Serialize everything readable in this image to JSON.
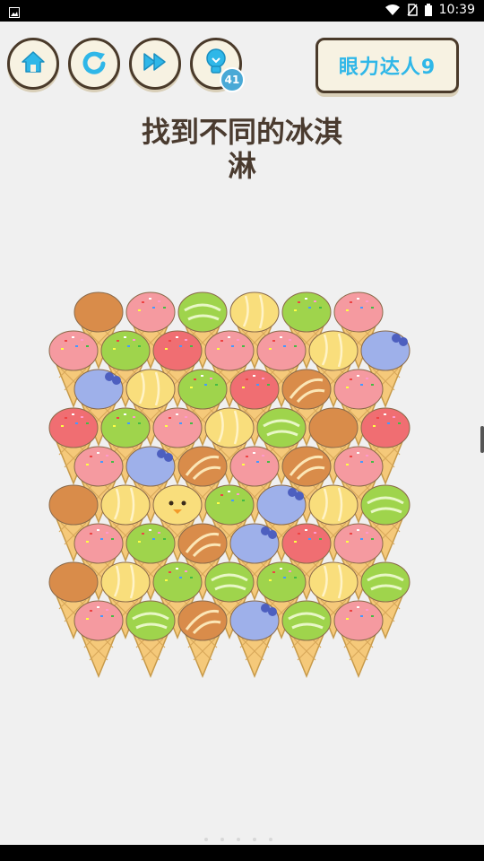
{
  "status_bar": {
    "time": "10:39"
  },
  "toolbar": {
    "home_icon": "home-icon",
    "restart_icon": "restart-icon",
    "skip_icon": "skip-icon",
    "hint_icon": "lightbulb-icon",
    "hint_count": "41"
  },
  "level": {
    "label": "眼力达人9"
  },
  "prompt": {
    "line1": "找到不同的冰淇",
    "line2": "淋"
  },
  "colors": {
    "brown": "#d98c4a",
    "pink": "#f59aa0",
    "green": "#9fd44c",
    "yellow": "#f9de7c",
    "blue": "#9eb0ea",
    "red": "#f06e72",
    "cone": "#f5c97a"
  },
  "board": {
    "rows": [
      [
        "brown",
        "pink",
        "green-swirl",
        "yellow",
        "green",
        "pink"
      ],
      [
        "pink",
        "green",
        "red",
        "pink",
        "pink",
        "yellow",
        "blue-bow"
      ],
      [
        "blue-bow",
        "yellow",
        "green",
        "red",
        "stripe",
        "pink"
      ],
      [
        "red",
        "green",
        "pink",
        "yellow",
        "green-swirl",
        "brown",
        "red"
      ],
      [
        "pink",
        "blue-bow",
        "stripe",
        "pink",
        "stripe",
        "pink"
      ],
      [
        "brown",
        "yellow",
        "duck",
        "green",
        "blue-bow",
        "yellow",
        "green-swirl"
      ],
      [
        "pink",
        "green",
        "stripe",
        "blue-bow",
        "red",
        "pink"
      ],
      [
        "brown",
        "yellow",
        "green",
        "green-swirl",
        "green",
        "yellow",
        "green-swirl"
      ],
      [
        "pink",
        "green-swirl",
        "stripe",
        "blue-bow",
        "green-swirl",
        "pink"
      ]
    ]
  }
}
